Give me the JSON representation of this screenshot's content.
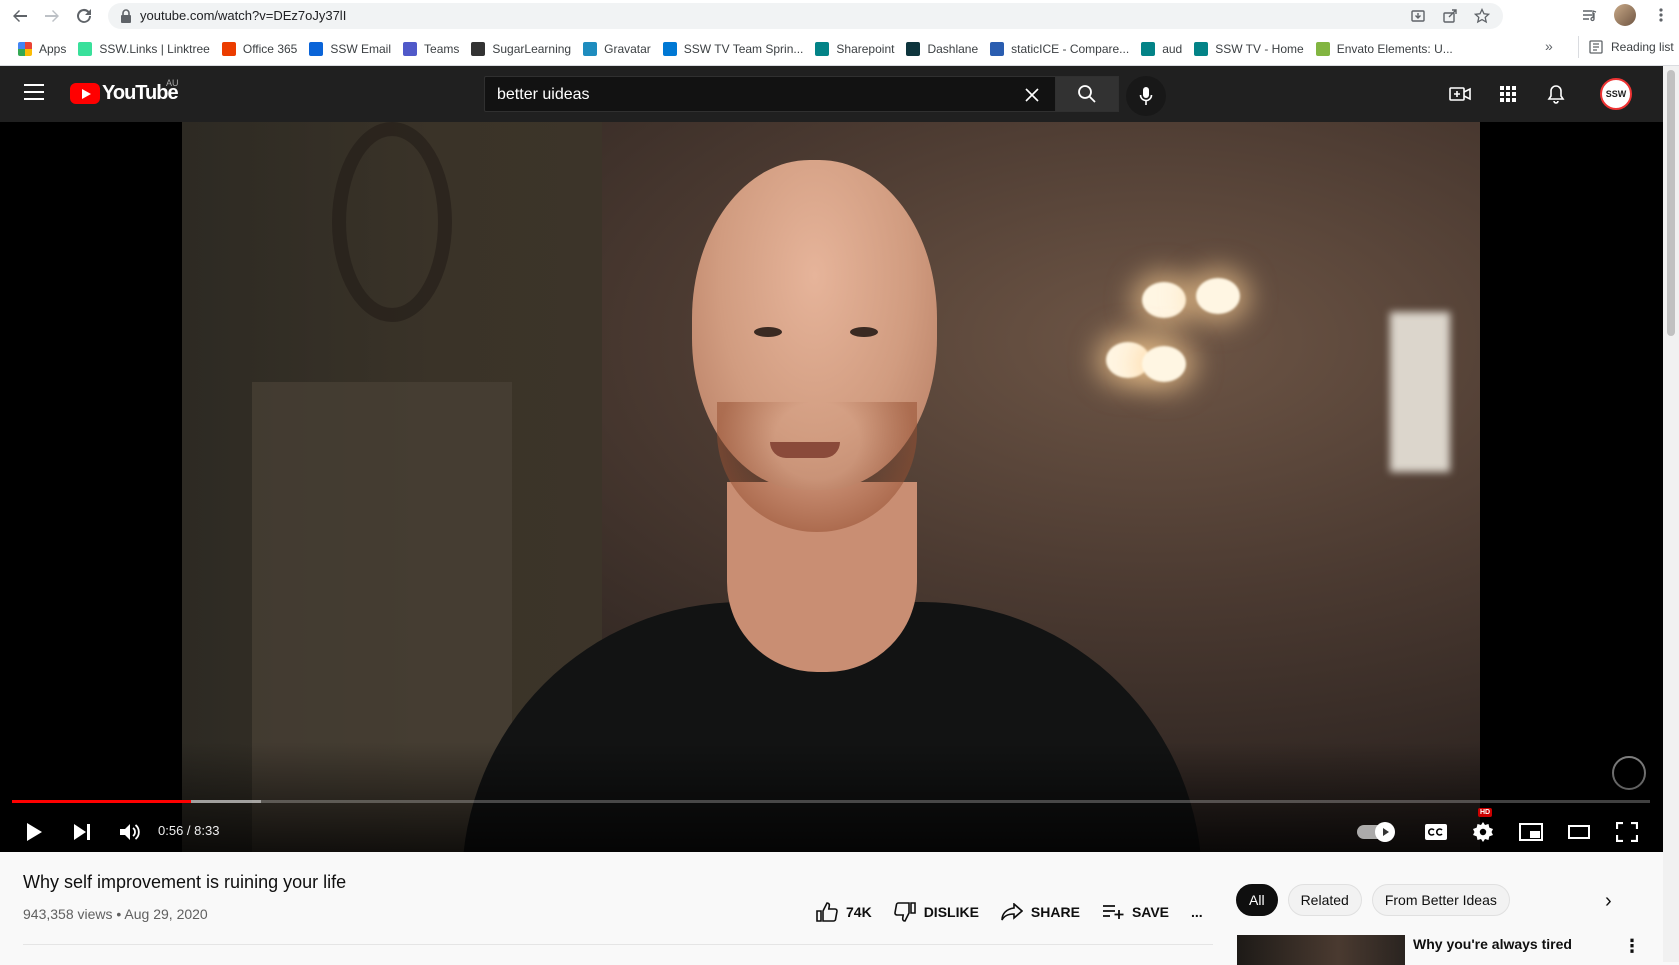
{
  "browser": {
    "url": "youtube.com/watch?v=DEz7oJy37lI",
    "bookmarks": [
      {
        "label": "Apps",
        "color": "#e8453c"
      },
      {
        "label": "SSW.Links | Linktree",
        "color": "#39e09b"
      },
      {
        "label": "Office 365",
        "color": "#eb3c00"
      },
      {
        "label": "SSW Email",
        "color": "#0a64d8"
      },
      {
        "label": "Teams",
        "color": "#5059c9"
      },
      {
        "label": "SugarLearning",
        "color": "#333333"
      },
      {
        "label": "Gravatar",
        "color": "#1e8cbe"
      },
      {
        "label": "SSW TV Team Sprin...",
        "color": "#0078d4"
      },
      {
        "label": "Sharepoint",
        "color": "#038387"
      },
      {
        "label": "Dashlane",
        "color": "#0e353d"
      },
      {
        "label": "staticICE - Compare...",
        "color": "#2a5db0"
      },
      {
        "label": "aud",
        "color": "#038387"
      },
      {
        "label": "SSW TV - Home",
        "color": "#038387"
      },
      {
        "label": "Envato Elements: U...",
        "color": "#82b541"
      }
    ],
    "bookmarks_more": "»",
    "reading_list": "Reading list"
  },
  "youtube": {
    "logo_text": "YouTube",
    "country_code": "AU",
    "search_value": "better uideas",
    "avatar_text": "SSW"
  },
  "player": {
    "current_time": "0:56",
    "duration": "8:33",
    "time_display": "0:56 / 8:33",
    "played_fraction": 0.109,
    "buffered_fraction": 0.152,
    "hd_badge": "HD"
  },
  "video": {
    "title": "Why self improvement is ruining your life",
    "views_date": "943,358 views • Aug 29, 2020",
    "likes": "74K",
    "dislike_label": "DISLIKE",
    "share_label": "SHARE",
    "save_label": "SAVE",
    "more_label": "..."
  },
  "sidebar": {
    "chips": [
      "All",
      "Related",
      "From Better Ideas"
    ],
    "next_arrow": "›",
    "recommended": [
      {
        "title": "Why you're always tired"
      }
    ]
  },
  "colors": {
    "accent": "#ff0000",
    "header_bg": "#202020",
    "page_bg": "#f9f9f9"
  }
}
